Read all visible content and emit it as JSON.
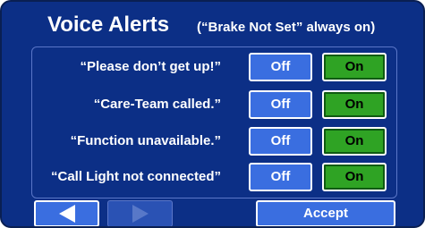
{
  "header": {
    "title": "Voice Alerts",
    "subtitle": "(“Brake Not Set” always on)"
  },
  "alerts": [
    {
      "label": "“Please don’t get up!”",
      "off_label": "Off",
      "on_label": "On",
      "state": "on"
    },
    {
      "label": "“Care-Team called.”",
      "off_label": "Off",
      "on_label": "On",
      "state": "on"
    },
    {
      "label": "“Function unavailable.”",
      "off_label": "Off",
      "on_label": "On",
      "state": "on"
    },
    {
      "label": "“Call Light not connected”",
      "off_label": "Off",
      "on_label": "On",
      "state": "on"
    }
  ],
  "footer": {
    "prev_icon": "left-arrow",
    "next_icon": "right-arrow",
    "accept_label": "Accept"
  },
  "colors": {
    "background": "#0c2f86",
    "button_blue": "#3a6ee0",
    "button_green_active": "#2fa324",
    "disabled_button": "#2a52b4"
  }
}
